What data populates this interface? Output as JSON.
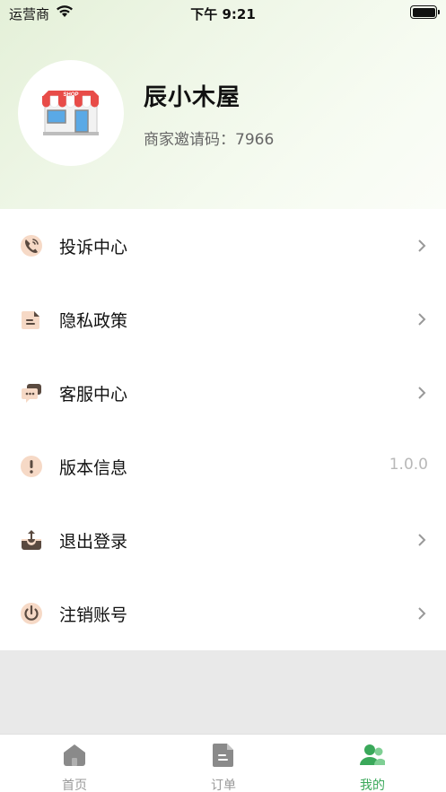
{
  "status_bar": {
    "carrier": "运营商",
    "time": "下午 9:21"
  },
  "profile": {
    "name": "辰小木屋",
    "invite_code_label": "商家邀请码：7966",
    "shop_sign": "SHOP"
  },
  "menu": {
    "items": [
      {
        "label": "投诉中心",
        "icon": "phone-icon"
      },
      {
        "label": "隐私政策",
        "icon": "document-icon"
      },
      {
        "label": "客服中心",
        "icon": "chat-icon"
      },
      {
        "label": "版本信息",
        "icon": "info-icon",
        "value": "1.0.0"
      },
      {
        "label": "退出登录",
        "icon": "logout-icon"
      },
      {
        "label": "注销账号",
        "icon": "power-icon"
      }
    ]
  },
  "tabbar": {
    "tabs": [
      {
        "label": "首页",
        "icon": "home-icon"
      },
      {
        "label": "订单",
        "icon": "order-icon"
      },
      {
        "label": "我的",
        "icon": "user-icon",
        "active": true
      }
    ]
  },
  "colors": {
    "accent": "#3aa85a",
    "icon_peach": "#f6d9c6",
    "icon_dark": "#5a4a40"
  }
}
